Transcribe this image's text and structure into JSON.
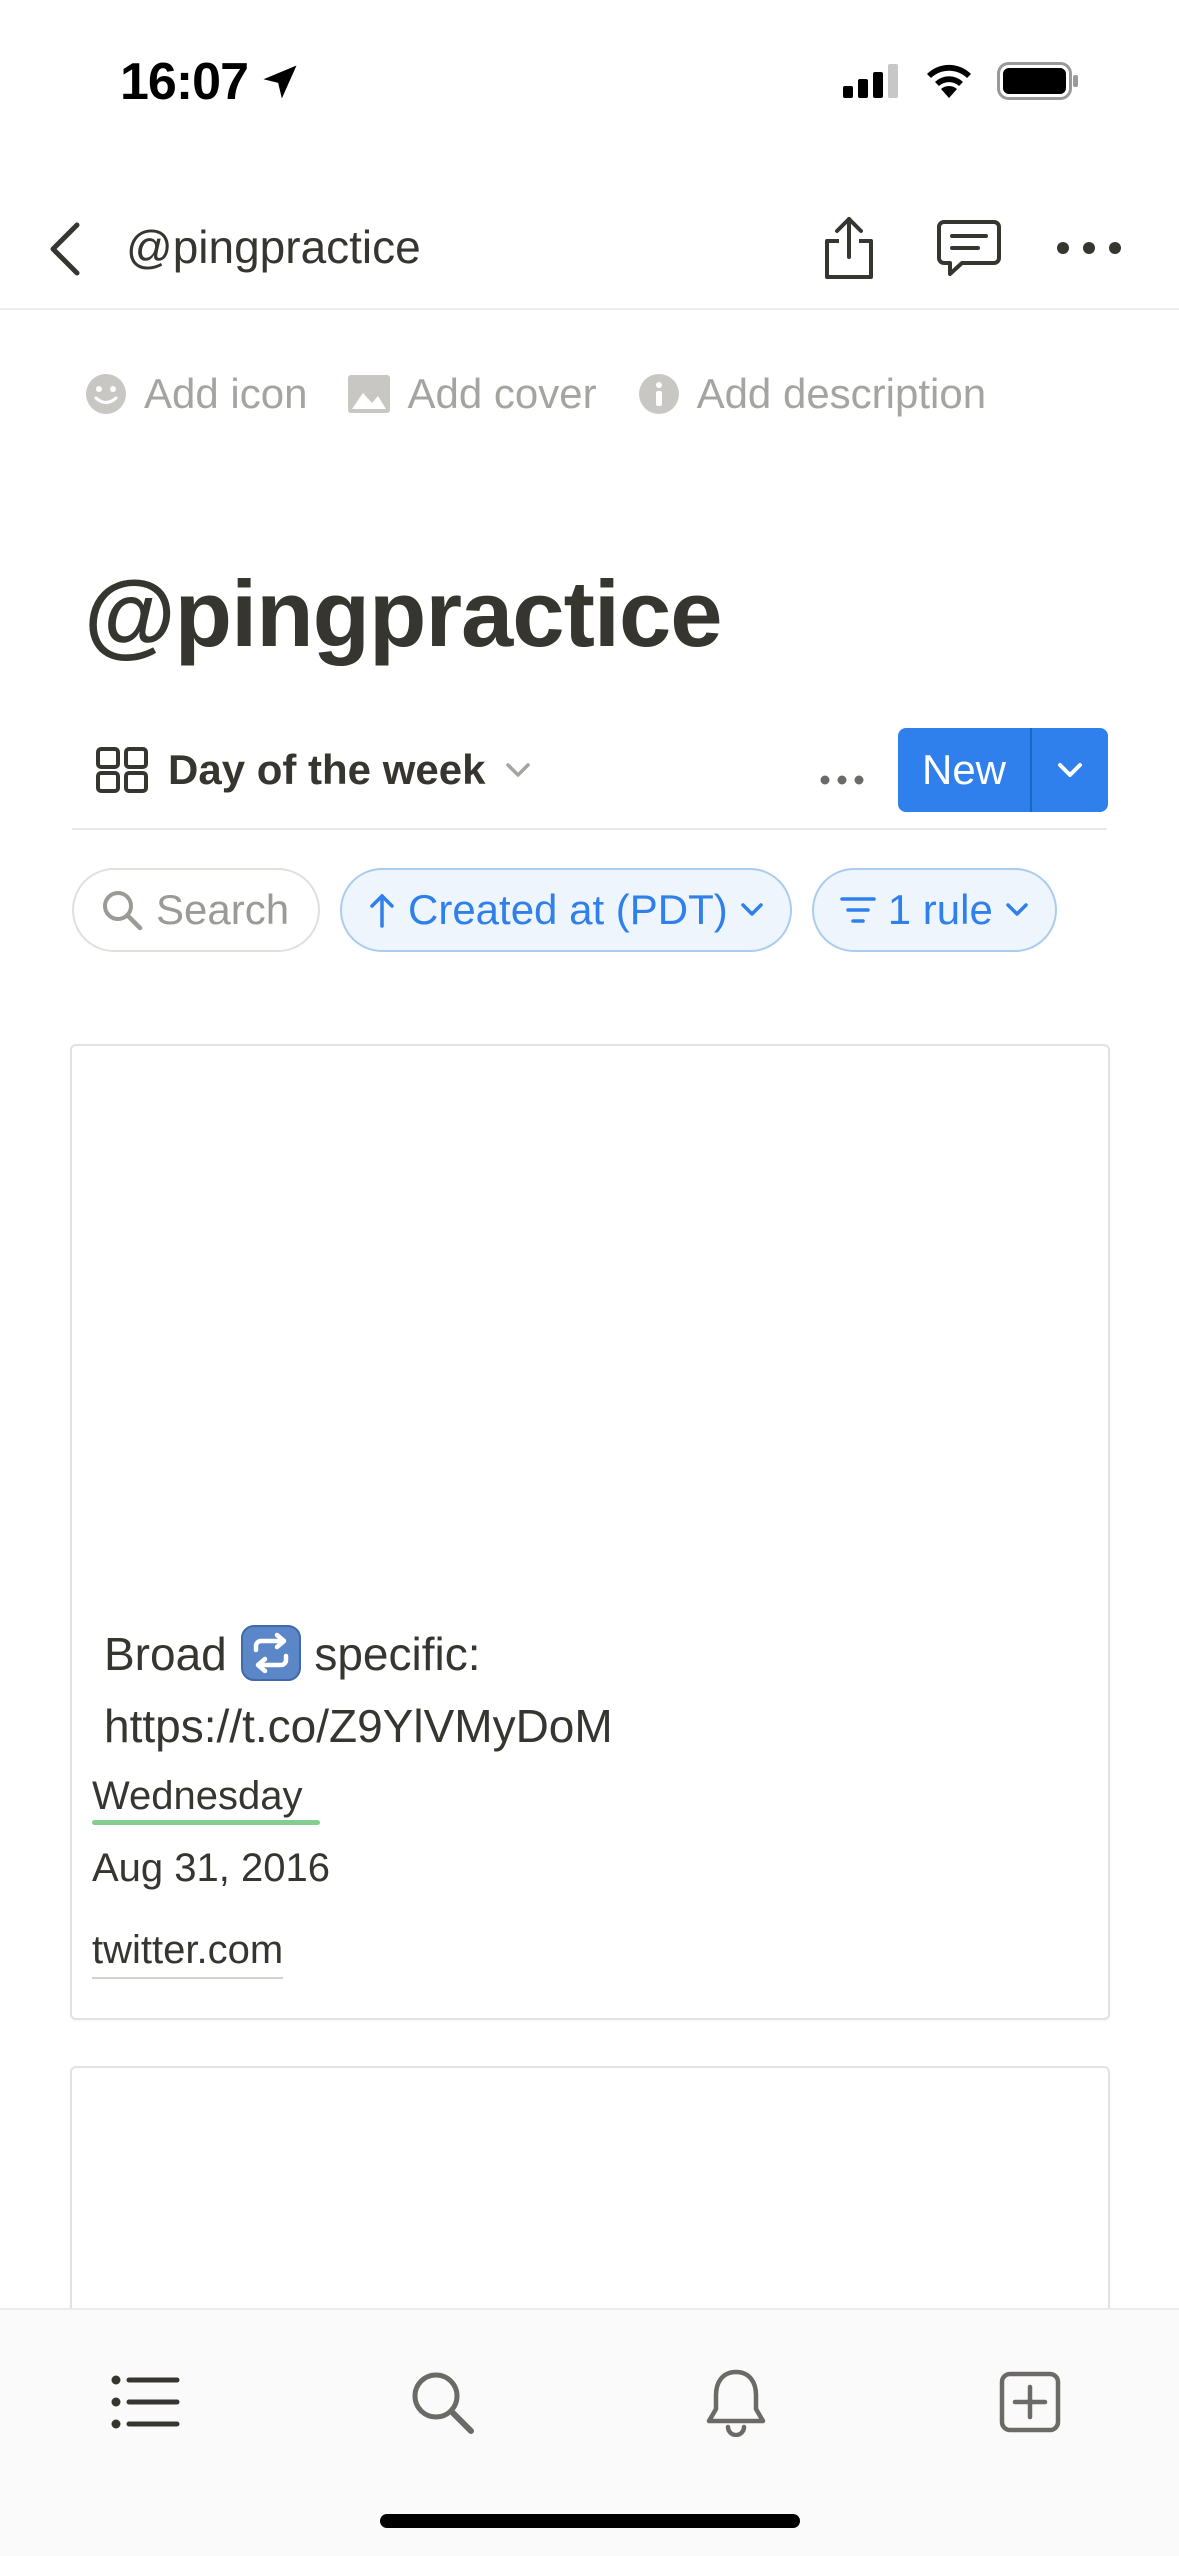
{
  "status_bar": {
    "time": "16:07",
    "icons": [
      "location-arrow-icon",
      "cellular-signal-icon",
      "wifi-icon",
      "battery-icon"
    ]
  },
  "nav": {
    "title": "@pingpractice",
    "icons": [
      "back-chevron-icon",
      "share-icon",
      "comment-icon",
      "more-icon"
    ]
  },
  "page_actions": {
    "add_icon": "Add icon",
    "add_cover": "Add cover",
    "add_description": "Add description"
  },
  "page": {
    "title": "@pingpractice"
  },
  "view": {
    "name": "Day of the week",
    "new_label": "New"
  },
  "chips": {
    "search": "Search",
    "sort": "Created at (PDT)",
    "filter": "1 rule"
  },
  "cards": [
    {
      "title_before": "Broad",
      "title_after": "specific:",
      "title_line2": "https://t.co/Z9YlVMyDoM",
      "day": "Wednesday",
      "date": "Aug 31, 2016",
      "url": "twitter.com"
    }
  ],
  "tab_bar": {
    "icons": [
      "list-icon",
      "search-icon",
      "bell-icon",
      "new-page-icon"
    ]
  },
  "colors": {
    "accent": "#2f80ed",
    "text": "#37352f",
    "muted": "#a5a4a1",
    "day_underline": "#6dc47c"
  }
}
